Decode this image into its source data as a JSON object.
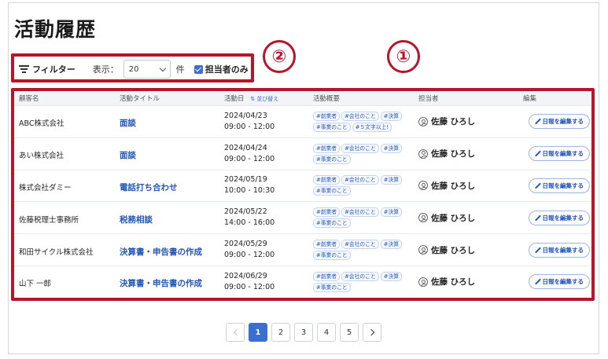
{
  "page": {
    "title": "活動履歴"
  },
  "annotations": {
    "marker_table": "①",
    "marker_filter": "②",
    "color": "#b5162b"
  },
  "filter": {
    "toggle_label": "フィルター",
    "display_label": "表示：",
    "per_page_value": "20",
    "unit_label": "件",
    "assignee_only_label": "担当者のみ",
    "assignee_only_checked": true
  },
  "table": {
    "headers": {
      "customer": "顧客名",
      "title": "活動タイトル",
      "date": "活動日",
      "sort": "並び替え",
      "summary": "活動概要",
      "assignee": "担当者",
      "edit": "編集"
    },
    "rows": [
      {
        "customer": "ABC株式会社",
        "title": "面談",
        "date": "2024/04/23",
        "time": "09:00 - 12:00",
        "tags": [
          "#創業者",
          "#会社のこと",
          "#決算",
          "#事業のこと",
          "#５文字以上!"
        ],
        "assignee": "佐藤 ひろし",
        "edit": "日報を編集する"
      },
      {
        "customer": "あい株式会社",
        "title": "面談",
        "date": "2024/04/24",
        "time": "09:00 - 12:00",
        "tags": [
          "#創業者",
          "#会社のこと",
          "#決算",
          "#事業のこと"
        ],
        "assignee": "佐藤 ひろし",
        "edit": "日報を編集する"
      },
      {
        "customer": "株式会社ダミー",
        "title": "電話打ち合わせ",
        "date": "2024/05/19",
        "time": "10:00 - 10:30",
        "tags": [
          "#創業者",
          "#会社のこと",
          "#決算",
          "#事業のこと"
        ],
        "assignee": "佐藤 ひろし",
        "edit": "日報を編集する"
      },
      {
        "customer": "佐藤税理士事務所",
        "title": "税務相談",
        "date": "2024/05/22",
        "time": "14:00 - 16:00",
        "tags": [
          "#創業者",
          "#会社のこと",
          "#決算",
          "#事業のこと"
        ],
        "assignee": "佐藤 ひろし",
        "edit": "日報を編集する"
      },
      {
        "customer": "和田サイクル株式会社",
        "title": "決算書・申告書の作成",
        "date": "2024/05/29",
        "time": "09:00 - 12:00",
        "tags": [
          "#創業者",
          "#会社のこと",
          "#決算",
          "#事業のこと"
        ],
        "assignee": "佐藤 ひろし",
        "edit": "日報を編集する"
      },
      {
        "customer": "山下 一郎",
        "title": "決算書・申告書の作成",
        "date": "2024/06/29",
        "time": "09:00 - 12:00",
        "tags": [
          "#創業者",
          "#会社のこと",
          "#決算",
          "#事業のこと"
        ],
        "assignee": "佐藤 ひろし",
        "edit": "日報を編集する"
      }
    ]
  },
  "pagination": {
    "pages": [
      "1",
      "2",
      "3",
      "4",
      "5"
    ],
    "current": "1",
    "accent": "#3a6fcf"
  }
}
